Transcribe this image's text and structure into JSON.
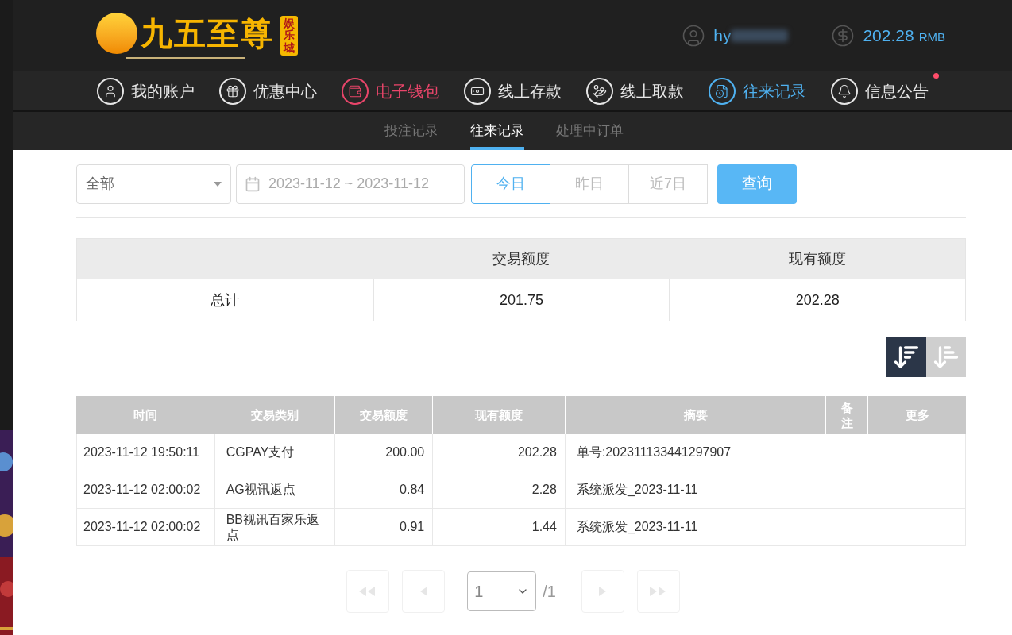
{
  "header": {
    "logo": {
      "name": "九五至尊",
      "tag": "娱乐城"
    },
    "username": "hy",
    "balance": "202.28",
    "currency": "RMB"
  },
  "nav": [
    {
      "label": "我的账户",
      "selected": false,
      "highlighted": false,
      "badge_dot": false
    },
    {
      "label": "优惠中心",
      "selected": false,
      "highlighted": false,
      "badge_dot": false
    },
    {
      "label": "电子钱包",
      "selected": false,
      "highlighted": true,
      "badge_dot": false
    },
    {
      "label": "线上存款",
      "selected": false,
      "highlighted": false,
      "badge_dot": false
    },
    {
      "label": "线上取款",
      "selected": false,
      "highlighted": false,
      "badge_dot": false
    },
    {
      "label": "往来记录",
      "selected": true,
      "highlighted": false,
      "badge_dot": false
    },
    {
      "label": "信息公告",
      "selected": false,
      "highlighted": false,
      "badge_dot": true
    }
  ],
  "subtabs": [
    {
      "label": "投注记录",
      "selected": false
    },
    {
      "label": "往来记录",
      "selected": true
    },
    {
      "label": "处理中订单",
      "selected": false
    }
  ],
  "filters": {
    "type_select": "全部",
    "date_range": "2023-11-12 ~ 2023-11-12",
    "quick_ranges": [
      {
        "label": "今日",
        "selected": true
      },
      {
        "label": "昨日",
        "selected": false
      },
      {
        "label": "近7日",
        "selected": false
      }
    ],
    "search_button": "查询"
  },
  "summary": {
    "columns": [
      "交易额度",
      "现有额度"
    ],
    "row": [
      "总计",
      "201.75",
      "202.28"
    ]
  },
  "sort": [
    {
      "kind": "desc",
      "selected": true
    },
    {
      "kind": "asc",
      "selected": false
    }
  ],
  "table": {
    "columns": [
      "时间",
      "交易类别",
      "交易额度",
      "现有额度",
      "摘要",
      "备注",
      "更多"
    ],
    "rows": [
      [
        "2023-11-12 19:50:11",
        "CGPAY支付",
        "200.00",
        "202.28",
        "单号:202311133441297907",
        "",
        ""
      ],
      [
        "2023-11-12 02:00:02",
        "AG视讯返点",
        "0.84",
        "2.28",
        "系统派发_2023-11-11",
        "",
        ""
      ],
      [
        "2023-11-12 02:00:02",
        "BB视讯百家乐返点",
        "0.91",
        "1.44",
        "系统派发_2023-11-11",
        "",
        ""
      ]
    ]
  },
  "pagination": {
    "page": "1",
    "total": "/1"
  }
}
